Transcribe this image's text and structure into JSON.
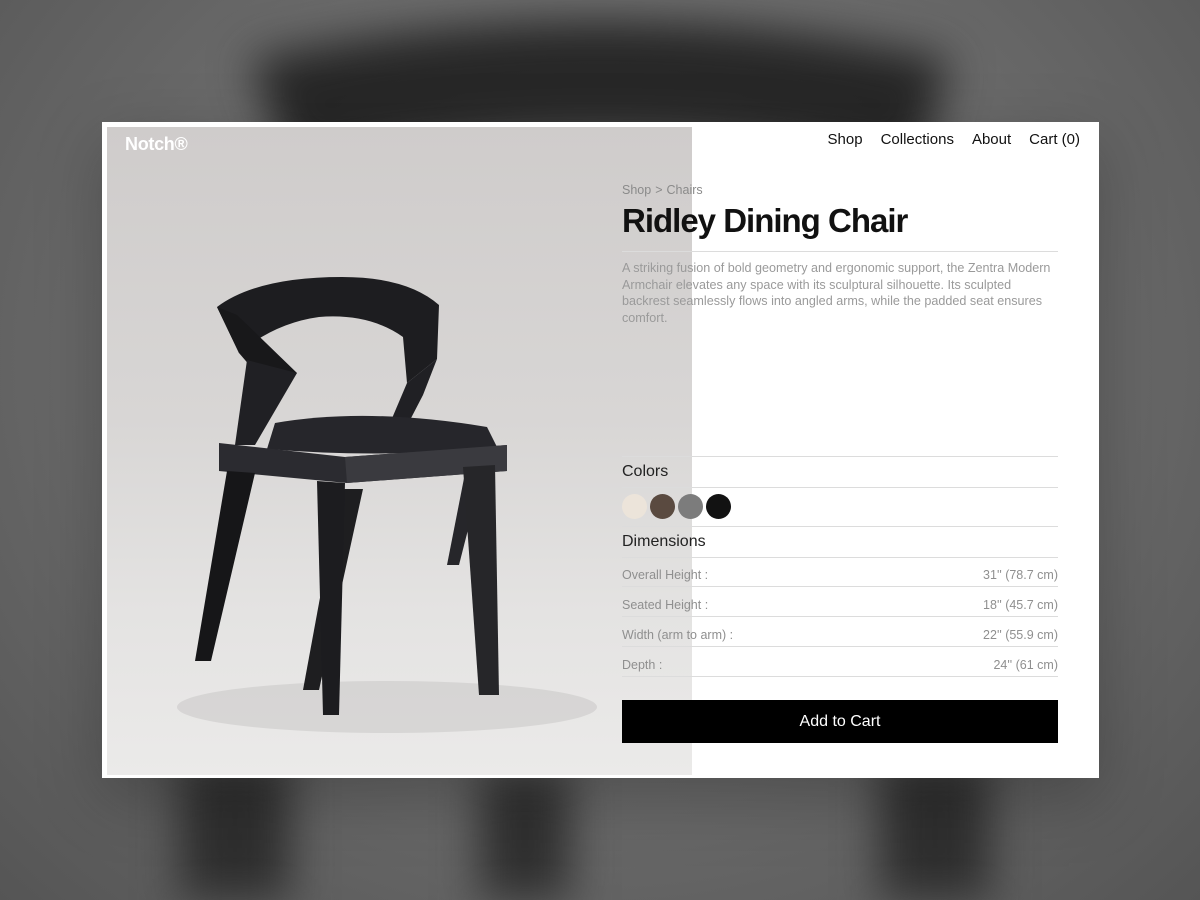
{
  "brand": {
    "logo": "Notch®"
  },
  "nav": {
    "items": [
      {
        "label": "Shop"
      },
      {
        "label": "Collections"
      },
      {
        "label": "About"
      },
      {
        "label": "Cart (0)"
      }
    ]
  },
  "breadcrumb": {
    "items": [
      "Shop",
      "Chairs"
    ],
    "separator": ">"
  },
  "product": {
    "title": "Ridley Dining Chair",
    "description": "A striking fusion of bold geometry and ergonomic support, the Zentra Modern Armchair elevates any space with its sculptural silhouette. Its sculpted backrest seamlessly flows into angled arms, while the padded seat ensures comfort.",
    "image_icon": "chair-photo"
  },
  "colors": {
    "label": "Colors",
    "swatches": [
      "#ece4da",
      "#5a4a40",
      "#7c7c7c",
      "#121212"
    ]
  },
  "dimensions": {
    "label": "Dimensions",
    "rows": [
      {
        "label": "Overall Height  :",
        "value": "31'' (78.7 cm)"
      },
      {
        "label": "Seated Height :",
        "value": "18'' (45.7 cm)"
      },
      {
        "label": "Width (arm to arm) :",
        "value": "22'' (55.9 cm)"
      },
      {
        "label": "Depth :",
        "value": "24'' (61 cm)"
      }
    ]
  },
  "cart_button": {
    "label": "Add to Cart"
  }
}
